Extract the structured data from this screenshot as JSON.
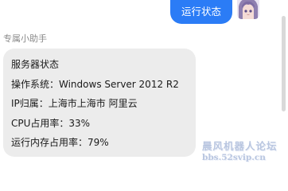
{
  "user_message": {
    "text": "运行状态"
  },
  "user_avatar": {
    "icon": "anime-girl-avatar",
    "hair_color": "#8f7fb0",
    "skin_color": "#f4dbd6"
  },
  "bot": {
    "sender_name": "专属小助手",
    "lines": [
      "服务器状态",
      "操作系统：Windows Server 2012 R2",
      "IP归属：上海市上海市 阿里云",
      "CPU占用率：33%",
      "运行内存占用率：79%"
    ]
  },
  "watermark": {
    "line1": "晨风机器人论坛",
    "line2": "bbs.52svip.cn"
  },
  "colors": {
    "user_bubble": "#2b7cf6",
    "bot_bubble": "#ececec",
    "watermark": "#b9c6e0"
  }
}
